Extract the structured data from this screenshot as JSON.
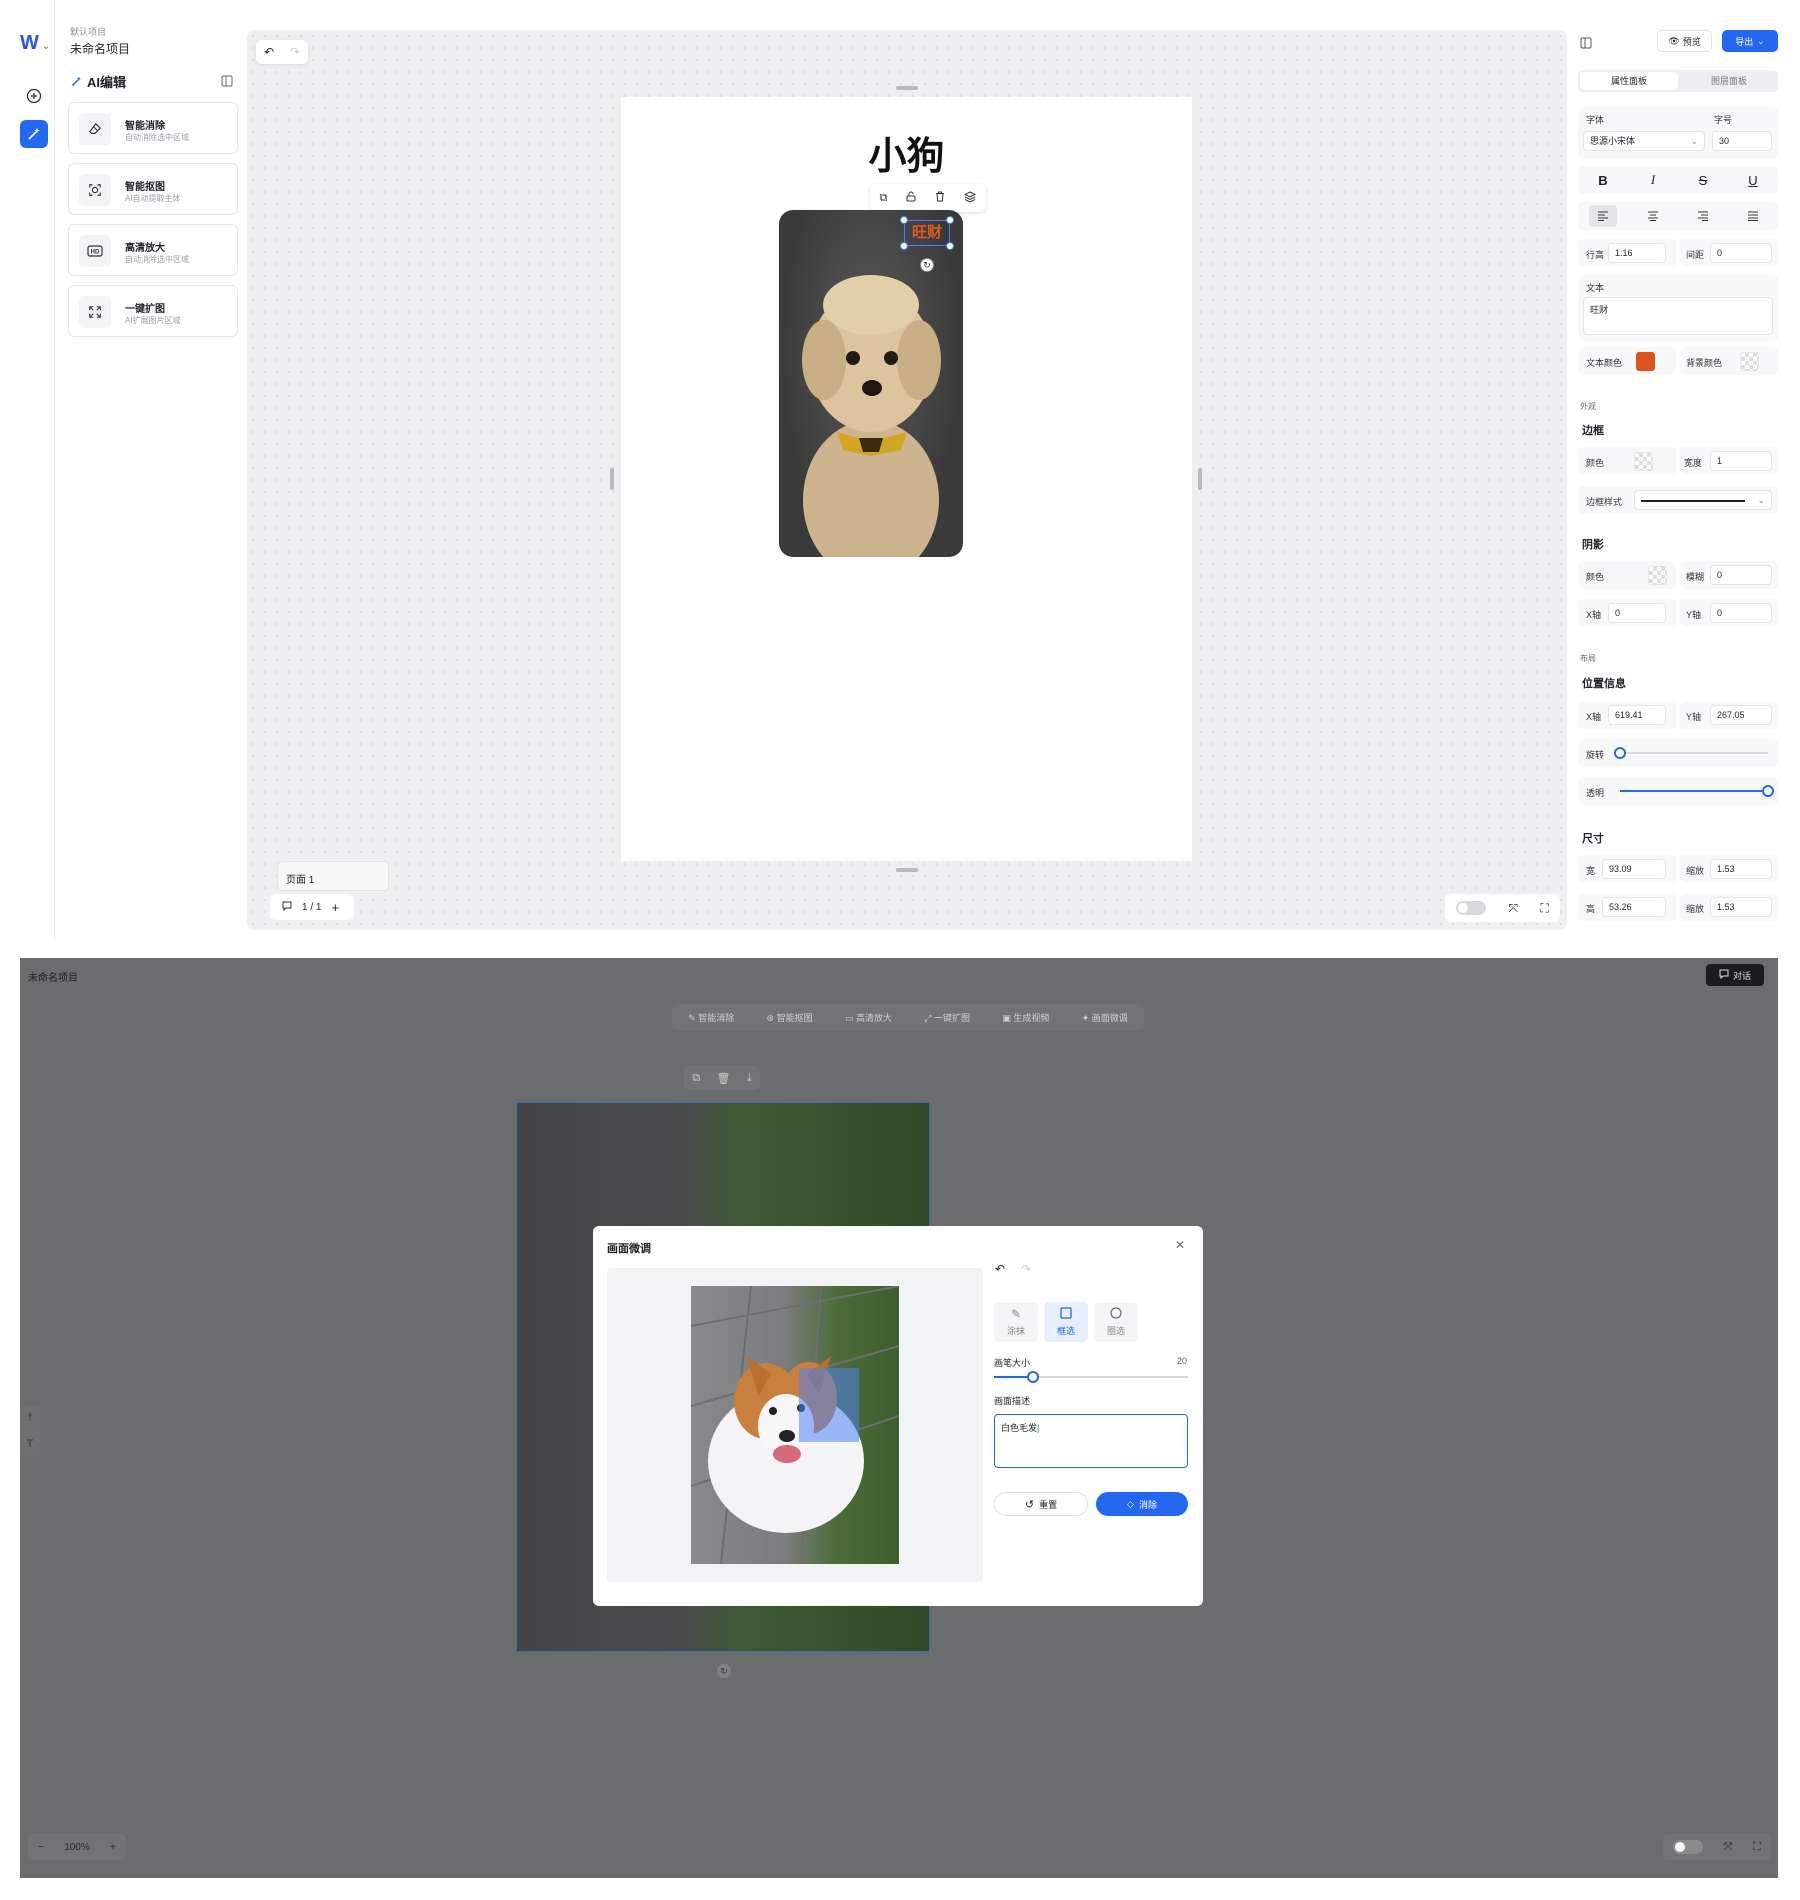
{
  "top": {
    "project": {
      "subtitle": "默认项目",
      "title": "未命名项目"
    },
    "ai_panel": {
      "title": "AI编辑",
      "tools": [
        {
          "title": "智能消除",
          "desc": "自动消除选中区域",
          "icon": "eraser-icon"
        },
        {
          "title": "智能抠图",
          "desc": "AI自动提取主体",
          "icon": "cutout-icon"
        },
        {
          "title": "高清放大",
          "desc": "自动消除选中区域",
          "icon": "hd-icon"
        },
        {
          "title": "一键扩图",
          "desc": "AI扩展图片区域",
          "icon": "expand-icon"
        }
      ]
    },
    "canvas": {
      "page_title": "小狗",
      "selected_text": "旺财",
      "page_label": "页面 1",
      "page_count": "1 / 1"
    },
    "right_panel": {
      "preview_label": "预览",
      "export_label": "导出",
      "tabs": [
        "属性面板",
        "图层面板"
      ],
      "font_label": "字体",
      "font_value": "思源小宋体",
      "size_label": "字号",
      "size_value": "30",
      "line_height_label": "行高",
      "line_height_value": "1.16",
      "spacing_label": "间距",
      "spacing_value": "0",
      "text_label": "文本",
      "text_value": "旺财",
      "text_color_label": "文本颜色",
      "text_color": "#d9541e",
      "bg_color_label": "背景颜色",
      "appearance_label": "外观",
      "border_title": "边框",
      "border_color_label": "颜色",
      "border_width_label": "宽度",
      "border_width_value": "1",
      "border_style_label": "边框样式",
      "shadow_title": "阴影",
      "shadow_color_label": "颜色",
      "shadow_blur_label": "模糊",
      "shadow_blur_value": "0",
      "shadow_x_label": "X轴",
      "shadow_x_value": "0",
      "shadow_y_label": "Y轴",
      "shadow_y_value": "0",
      "layout_label": "布局",
      "position_title": "位置信息",
      "pos_x_label": "X轴",
      "pos_x_value": "619.41",
      "pos_y_label": "Y轴",
      "pos_y_value": "267.05",
      "rotate_label": "旋转",
      "rotate_level": 0,
      "opacity_label": "透明",
      "opacity_level": 1,
      "size_title": "尺寸",
      "width_label": "宽",
      "width_value": "93.09",
      "scale_label": "缩放",
      "scale_w_value": "1.53",
      "height_label": "高",
      "height_value": "53.26",
      "scale_h_value": "1.53"
    }
  },
  "bottom": {
    "project_title": "未命名项目",
    "chat_label": "对话",
    "toolbar": [
      "智能消除",
      "智能抠图",
      "高清放大",
      "一键扩图",
      "生成视频",
      "画面微调"
    ],
    "zoom": "100%",
    "modal": {
      "title": "画面微调",
      "tools": [
        "涂抹",
        "框选",
        "圈选"
      ],
      "active_tool": "框选",
      "brush_label": "画笔大小",
      "brush_value": "20",
      "brush_level": 0.2,
      "desc_label": "画面描述",
      "desc_value": "白色毛发",
      "reset_label": "重置",
      "erase_label": "消除"
    }
  },
  "colors": {
    "accent": "#2468f2",
    "text_color_swatch": "#d9541e",
    "dark_overlay": "#6b6c6e"
  }
}
